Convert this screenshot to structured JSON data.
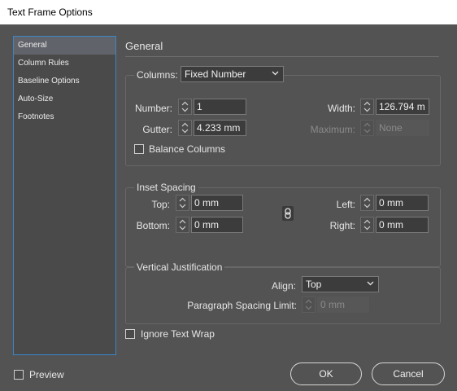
{
  "window": {
    "title": "Text Frame Options"
  },
  "sidebar": {
    "items": [
      {
        "label": "General"
      },
      {
        "label": "Column Rules"
      },
      {
        "label": "Baseline Options"
      },
      {
        "label": "Auto-Size"
      },
      {
        "label": "Footnotes"
      }
    ],
    "selected_index": 0
  },
  "general": {
    "title": "General",
    "columns_group": {
      "columns_label": "Columns:",
      "columns_type": "Fixed Number",
      "number_label": "Number:",
      "number_value": "1",
      "gutter_label": "Gutter:",
      "gutter_value": "4.233 mm",
      "width_label": "Width:",
      "width_value": "126.794 m",
      "maximum_label": "Maximum:",
      "maximum_value": "None",
      "balance_label": "Balance Columns",
      "balance_checked": false
    },
    "inset_group": {
      "title": "Inset Spacing",
      "top_label": "Top:",
      "top_value": "0 mm",
      "bottom_label": "Bottom:",
      "bottom_value": "0 mm",
      "left_label": "Left:",
      "left_value": "0 mm",
      "right_label": "Right:",
      "right_value": "0 mm"
    },
    "vj_group": {
      "title": "Vertical Justification",
      "align_label": "Align:",
      "align_value": "Top",
      "psl_label": "Paragraph Spacing Limit:",
      "psl_value": "0 mm"
    },
    "ignore_wrap_label": "Ignore Text Wrap",
    "ignore_wrap_checked": false
  },
  "footer": {
    "preview_label": "Preview",
    "preview_checked": false,
    "ok_label": "OK",
    "cancel_label": "Cancel"
  },
  "colors": {
    "background": "#535353",
    "field": "#3c3c3c",
    "selection_border": "#3b86c6"
  },
  "icons": [
    "spinner-icon",
    "chevron-down-icon",
    "chain-link-icon"
  ]
}
